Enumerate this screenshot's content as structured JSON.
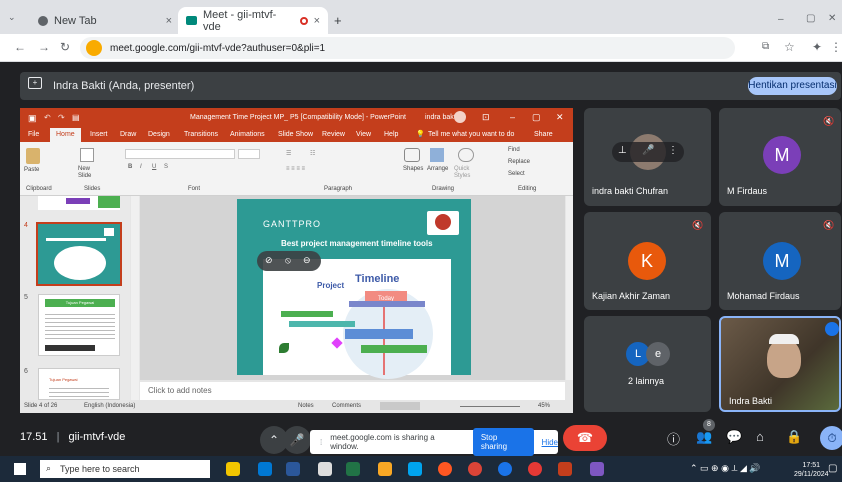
{
  "browser": {
    "tabs": [
      {
        "label": "New Tab",
        "close": "×"
      },
      {
        "label": "Meet - gii-mtvf-vde",
        "close": "×"
      }
    ],
    "new_tab": "+",
    "url": "meet.google.com/gii-mtvf-vde?authuser=0&pli=1",
    "window_controls": [
      "–",
      "▢",
      "✕"
    ]
  },
  "meet": {
    "presenter_label": "Indra Bakti (Anda, presenter)",
    "stop_presenting": "Hentikan presentasi",
    "meeting_time": "17.51",
    "separator": "|",
    "meeting_code": "gii-mtvf-vde",
    "sharing_text": "meet.google.com is sharing a window.",
    "stop_sharing": "Stop sharing",
    "hide": "Hide",
    "participant_count_badge": "8"
  },
  "participants": [
    {
      "name": "indra bakti Chufran",
      "kind": "video-muted"
    },
    {
      "name": "M Firdaus",
      "initial": "M",
      "color": "#7b3fb8"
    },
    {
      "name": "Kajian Akhir Zaman",
      "initial": "K",
      "color": "#e8590c"
    },
    {
      "name": "Mohamad Firdaus",
      "initial": "M",
      "color": "#1565c0"
    },
    {
      "name": "2 lainnya",
      "initials": [
        "L",
        "e"
      ]
    },
    {
      "name": "Indra Bakti",
      "kind": "video"
    }
  ],
  "ppt": {
    "title": "Management Time Project MP_ P5 [Compatibility Mode] - PowerPoint",
    "user": "indra bakti",
    "menu": [
      "File",
      "Home",
      "Insert",
      "Draw",
      "Design",
      "Transitions",
      "Animations",
      "Slide Show",
      "Review",
      "View",
      "Help"
    ],
    "tell_me": "Tell me what you want to do",
    "share": "Share",
    "ribbon_groups": [
      "Clipboard",
      "Slides",
      "Font",
      "Paragraph",
      "Drawing",
      "Editing"
    ],
    "ribbon_buttons": {
      "paste": "Paste",
      "new_slide": "New Slide",
      "shapes": "Shapes",
      "arrange": "Arrange",
      "quick_styles": "Quick Styles",
      "find": "Find",
      "replace": "Replace",
      "select": "Select"
    },
    "thumb_numbers": [
      "4",
      "5",
      "6"
    ],
    "thumb5_title": "Tujuan Pegawai",
    "thumb6_title": "Tujuan Pegawai",
    "slide": {
      "brand": "GANTTPRO",
      "headline": "Best project management timeline tools",
      "project": "Project",
      "timeline": "Timeline",
      "today": "Today"
    },
    "notes_placeholder": "Click to add notes",
    "status": {
      "slide_of": "Slide 4 of 26",
      "language": "English (Indonesia)",
      "notes": "Notes",
      "comments": "Comments",
      "zoom": "45%"
    }
  },
  "taskbar": {
    "search_placeholder": "Type here to search",
    "time": "17:51",
    "date": "29/11/2024"
  }
}
